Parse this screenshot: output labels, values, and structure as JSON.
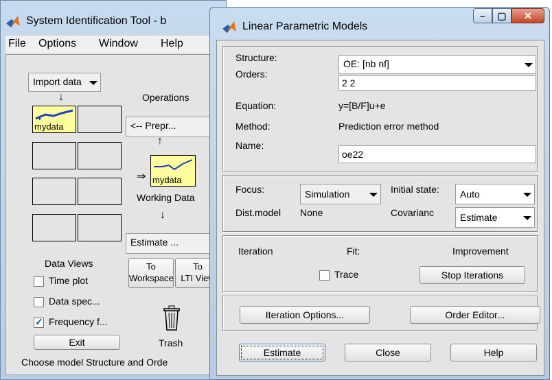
{
  "back_window": {
    "title": "System Identification Tool - b",
    "menu": [
      "File",
      "Options",
      "Window",
      "Help"
    ],
    "import_data": "Import data",
    "operations_label": "Operations",
    "preprocess": "<-- Prepr...",
    "data_cell_label": "mydata",
    "working_data_cell_label": "mydata",
    "working_data_label": "Working Data",
    "estimate": "Estimate ...",
    "data_views_label": "Data Views",
    "to_workspace": [
      "To",
      "Workspace"
    ],
    "to_view": [
      "To",
      "LTI View"
    ],
    "checkboxes": [
      {
        "label": "Time plot",
        "checked": false
      },
      {
        "label": "Data spec...",
        "checked": false
      },
      {
        "label": "Frequency f...",
        "checked": true
      }
    ],
    "trash_label": "Trash",
    "exit_label": "Exit",
    "status_text": "Choose model Structure and Orde"
  },
  "front_window": {
    "title": "Linear Parametric Models",
    "structure_label": "Structure:",
    "structure_value": "OE: [nb nf]",
    "orders_label": "Orders:",
    "orders_value": "2 2",
    "equation_label": "Equation:",
    "equation_value": "y=[B/F]u+e",
    "method_label": "Method:",
    "method_value": "Prediction error method",
    "name_label": "Name:",
    "name_value": "oe22",
    "focus_label": "Focus:",
    "focus_value": "Simulation",
    "initial_state_label": "Initial state:",
    "initial_state_value": "Auto",
    "dist_model_label": "Dist.model",
    "dist_model_value": "None",
    "covariance_label": "Covarianc",
    "covariance_value": "Estimate",
    "iteration_label": "Iteration",
    "fit_label": "Fit:",
    "improvement_label": "Improvement",
    "trace_label": "Trace",
    "stop_iterations": "Stop Iterations",
    "iteration_options": "Iteration Options...",
    "order_editor": "Order Editor...",
    "estimate": "Estimate",
    "close": "Close",
    "help": "Help"
  },
  "colors": {
    "accent_yellow": "#fffe9e",
    "plot_blue": "#1a3fc4",
    "frame_blue": "#c9dcf0",
    "close_red": "#c3472a"
  }
}
